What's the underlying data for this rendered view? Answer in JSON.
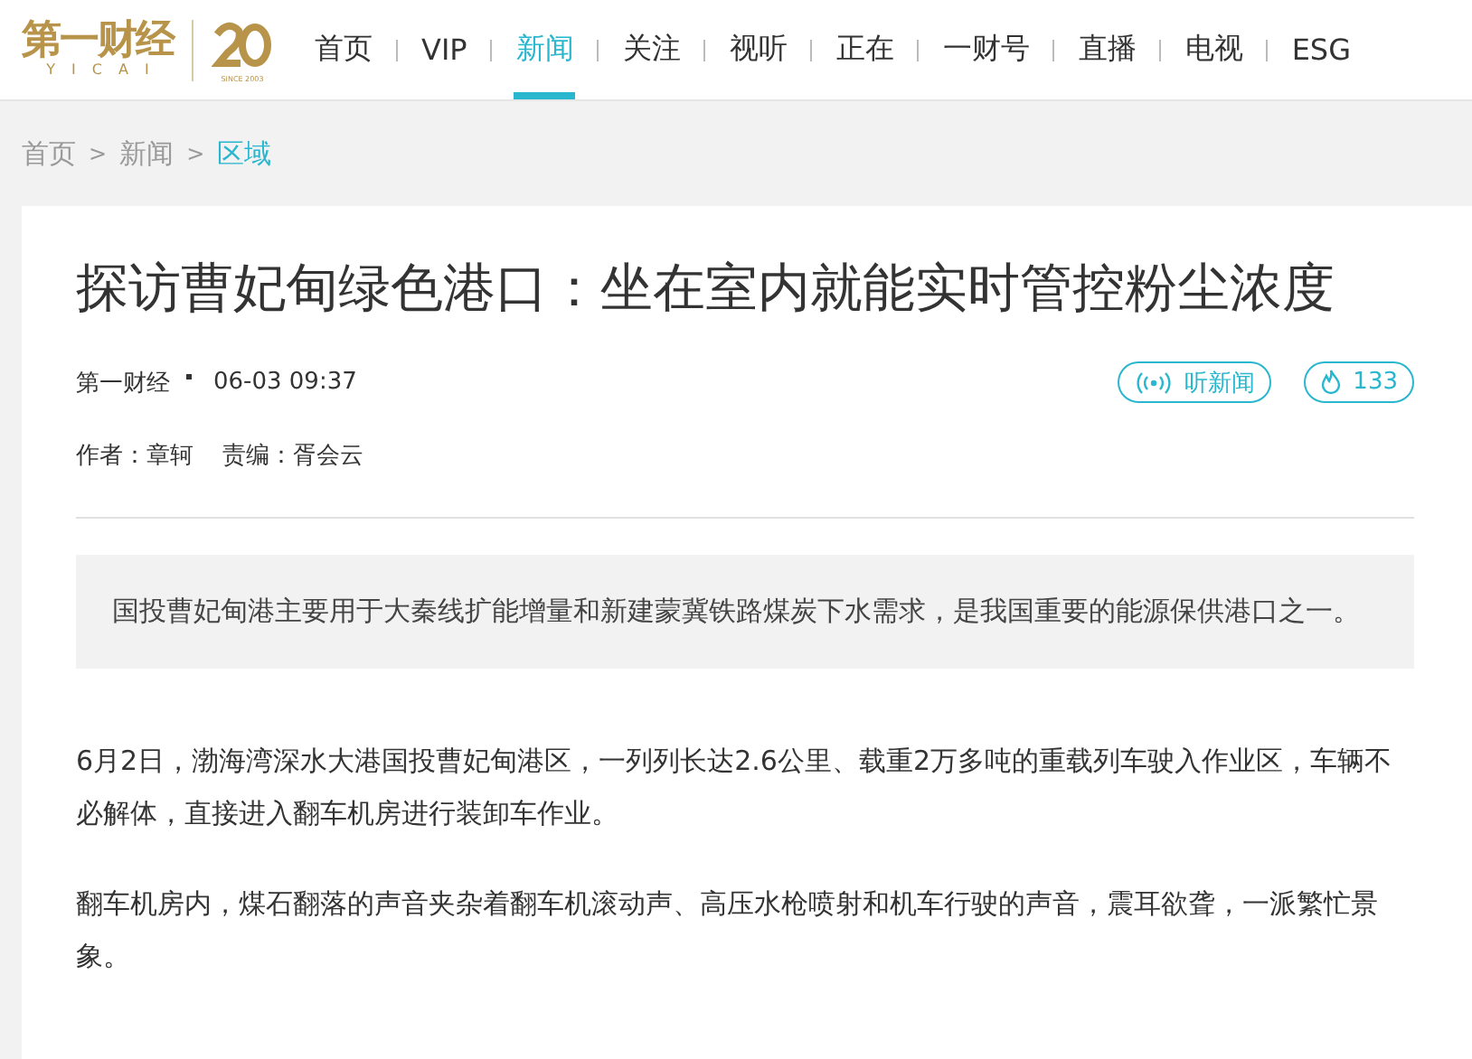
{
  "header": {
    "logo": {
      "wordmark": "第一财经",
      "latin": "YICAI",
      "since": "SINCE 2003"
    },
    "nav": [
      {
        "label": "首页",
        "selected": false
      },
      {
        "label": "VIP",
        "selected": false
      },
      {
        "label": "新闻",
        "selected": true
      },
      {
        "label": "关注",
        "selected": false
      },
      {
        "label": "视听",
        "selected": false
      },
      {
        "label": "正在",
        "selected": false
      },
      {
        "label": "一财号",
        "selected": false
      },
      {
        "label": "直播",
        "selected": false
      },
      {
        "label": "电视",
        "selected": false
      },
      {
        "label": "ESG",
        "selected": false
      }
    ]
  },
  "breadcrumb": [
    {
      "label": "首页",
      "selected": false
    },
    {
      "label": "新闻",
      "selected": false
    },
    {
      "label": "区域",
      "selected": true
    }
  ],
  "breadcrumb_separator": ">",
  "article": {
    "title": "探访曹妃甸绿色港口：坐在室内就能实时管控粉尘浓度",
    "source": "第一财经",
    "time": "06-03 09:37",
    "listen_button": "听新闻",
    "heat_count": "133",
    "author_label": "作者：",
    "author": "章轲",
    "editor_label": "责编：",
    "editor": "胥会云",
    "summary": "国投曹妃甸港主要用于大秦线扩能增量和新建蒙冀铁路煤炭下水需求，是我国重要的能源保供港口之一。",
    "paragraphs": [
      "6月2日，渤海湾深水大港国投曹妃甸港区，一列列长达2.6公里、载重2万多吨的重载列车驶入作业区，车辆不必解体，直接进入翻车机房进行装卸车作业。",
      "翻车机房内，煤石翻落的声音夹杂着翻车机滚动声、高压水枪喷射和机车行驶的声音，震耳欲聋，一派繁忙景象。"
    ]
  }
}
